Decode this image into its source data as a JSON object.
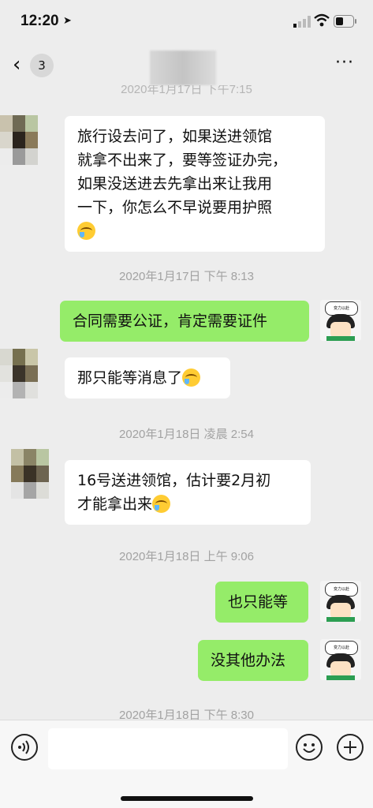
{
  "status": {
    "time": "12:20"
  },
  "nav": {
    "unread_count": "3",
    "more": "···"
  },
  "messages": [
    {
      "stamp": "2020年1月17日 下午7:15"
    },
    {
      "incoming_1": "旅行设去问了，如果送进领馆\n就拿不出来了，要等签证办完，\n如果没送进去先拿出来让我用\n一下，你怎么不早说要用护照"
    },
    {
      "stamp": "2020年1月17日 下午 8:13"
    },
    {
      "outgoing_1": "合同需要公证，肯定需要证件"
    },
    {
      "incoming_2": "那只能等消息了"
    },
    {
      "stamp": "2020年1月18日 凌晨 2:54"
    },
    {
      "incoming_3": "16号送进领馆，估计要2月初\n才能拿出来"
    },
    {
      "stamp": "2020年1月18日 上午 9:06"
    },
    {
      "outgoing_2": "也只能等"
    },
    {
      "outgoing_3": "没其他办法"
    },
    {
      "stamp": "2020年1月18日 下午 8:30"
    }
  ],
  "avatar_me_caption": "变力以赴",
  "colors": {
    "outgoing": "#95ec69",
    "incoming": "#ffffff",
    "background": "#ededed"
  },
  "icons": {
    "voice": "voice-icon",
    "emoji": "emoji-icon",
    "plus": "plus-icon"
  }
}
